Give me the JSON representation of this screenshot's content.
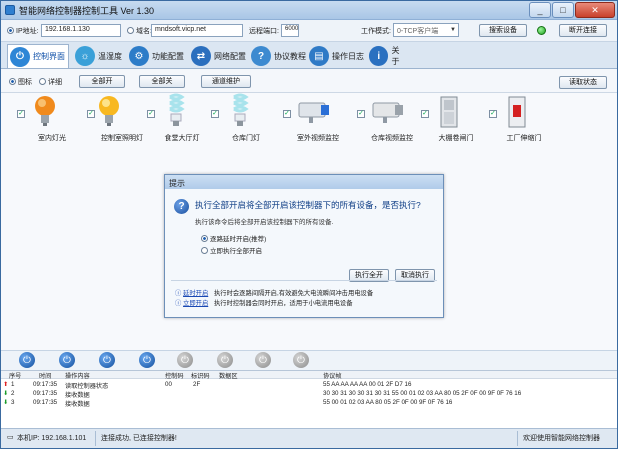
{
  "window": {
    "title": "智能网络控制器控制工具 Ver 1.30",
    "min": "_",
    "max": "□",
    "close": "✕"
  },
  "settings": {
    "ip_label": "IP地址:",
    "ip_value": "192.168.1.130",
    "domain_label": "域名:",
    "domain_value": "mndsoft.vicp.net",
    "port_label": "远程端口:",
    "port_value": "6000",
    "mode_label": "工作模式:",
    "mode_value": "0-TCP客户端",
    "search_btn": "搜索设备",
    "disconnect_btn": "断开连接"
  },
  "tabs": [
    {
      "label": "控制界面",
      "color": "#2e86d6",
      "glyph": "⏻"
    },
    {
      "label": "温湿度",
      "color": "#3aa0d8",
      "glyph": "☼"
    },
    {
      "label": "功能配置",
      "color": "#2c7cc8",
      "glyph": "⚙"
    },
    {
      "label": "网络配置",
      "color": "#2b6fbe",
      "glyph": "⇄"
    },
    {
      "label": "协议教程",
      "color": "#3d8ad0",
      "glyph": "?"
    },
    {
      "label": "操作日志",
      "color": "#2f7ac6",
      "glyph": "▤"
    },
    {
      "label": "关于",
      "color": "#2a70c0",
      "glyph": "i"
    }
  ],
  "toolbar": {
    "view_icon": "图标",
    "view_detail": "详细",
    "all_on": "全部开",
    "all_off": "全部关",
    "channel_maint": "通道维护",
    "read_status": "读取状态"
  },
  "devices": [
    {
      "label": "室内灯光",
      "icon": "bulb-orange-icon"
    },
    {
      "label": "控制室照明灯",
      "icon": "bulb-yellow-icon"
    },
    {
      "label": "食堂大厅灯",
      "icon": "cfl-bulb-icon"
    },
    {
      "label": "仓库门灯",
      "icon": "cfl-bulb-icon"
    },
    {
      "label": "室外视频监控",
      "icon": "camera-icon"
    },
    {
      "label": "仓库视频监控",
      "icon": "camera-icon"
    },
    {
      "label": "大棚卷闸门",
      "icon": "door-icon"
    },
    {
      "label": "工厂伸缩门",
      "icon": "switch-icon"
    }
  ],
  "power_buttons": [
    "on",
    "on",
    "on",
    "on",
    "off",
    "off",
    "off",
    "off"
  ],
  "log": {
    "headers": [
      "序号",
      "时间",
      "操作内容",
      "控制码",
      "标识码",
      "数据区",
      "协议帧"
    ],
    "rows": [
      {
        "no": "1",
        "time": "09:17:35",
        "op": "读取控制器状态",
        "code": "00",
        "flag": "2F",
        "data": "",
        "frame": "55 AA AA AA AA 00 01 2F D7 16"
      },
      {
        "no": "2",
        "time": "09:17:35",
        "op": "接收数据",
        "code": "",
        "flag": "",
        "data": "",
        "frame": "30 30 31 30 30 31 30 31 55 00 01 02 03 AA 80 05 2F 0F 00 9F 0F 76 16"
      },
      {
        "no": "3",
        "time": "09:17:35",
        "op": "接收数据",
        "code": "",
        "flag": "",
        "data": "",
        "frame": "55 00 01 02 03 AA 80 05 2F 0F 00 9F 0F 76 16"
      }
    ]
  },
  "footer": {
    "local_ip": "本机IP: 192.168.1.101",
    "status": "连接成功, 已连接控制器!",
    "welcome": "欢迎使用智能网络控制器"
  },
  "dialog": {
    "title": "提示",
    "heading": "执行全部开启将全部开启该控制器下的所有设备，是否执行?",
    "sub": "执行该命令后将全部开启该控制器下的所有设备.",
    "opt1": "逐路延时开启(推荐)",
    "opt2": "立即执行全部开启",
    "exec_btn": "执行全开",
    "cancel_btn": "取消执行",
    "note1_link": "延时开启",
    "note1_text": "执行时会逐路间隔开启,有效避免大电流瞬间冲击用电设备",
    "note2_link": "立即开启",
    "note2_text": "执行时控制器会同时开启，适用于小电流用电设备"
  }
}
